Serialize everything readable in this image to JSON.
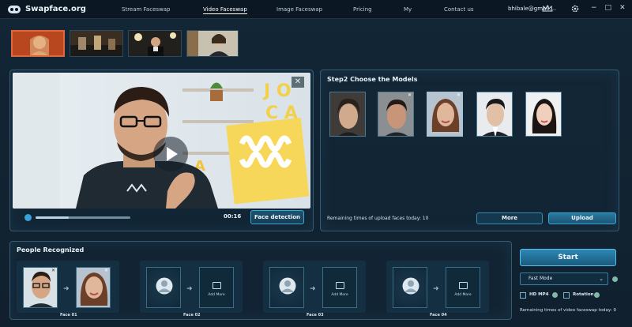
{
  "app": {
    "title": "Swapface.org"
  },
  "nav": {
    "items": [
      "Stream Faceswap",
      "Video Faceswap",
      "Image Faceswap",
      "Pricing",
      "My",
      "Contact us"
    ],
    "active_index": 1
  },
  "user": {
    "email": "bhibale@gmail...."
  },
  "window_controls": {
    "minimize": "−",
    "maximize": "□",
    "close": "✕"
  },
  "video": {
    "time": "00:16",
    "progress": 0.35,
    "face_detection_label": "Face detection",
    "close": "✕"
  },
  "models_panel": {
    "title": "Step2 Choose the Models",
    "remaining_upload": "Remaining times of upload faces today: 10",
    "more_label": "More",
    "upload_label": "Upload"
  },
  "people": {
    "title": "People Recognized",
    "faces": [
      {
        "label": "Face 01",
        "has_source": true
      },
      {
        "label": "Face 02",
        "has_source": false
      },
      {
        "label": "Face 03",
        "has_source": false
      },
      {
        "label": "Face 04",
        "has_source": false
      }
    ],
    "add_more_label": "Add More"
  },
  "controls": {
    "start_label": "Start",
    "mode_value": "Fast Mode",
    "hd_mp4_label": "HD MP4",
    "rotation_label": "Rotation",
    "remaining_video": "Remaining times of video faceswap today: 9"
  },
  "colors": {
    "accent": "#2c87b2",
    "panel_border": "#355b73",
    "background": "#10202e"
  }
}
